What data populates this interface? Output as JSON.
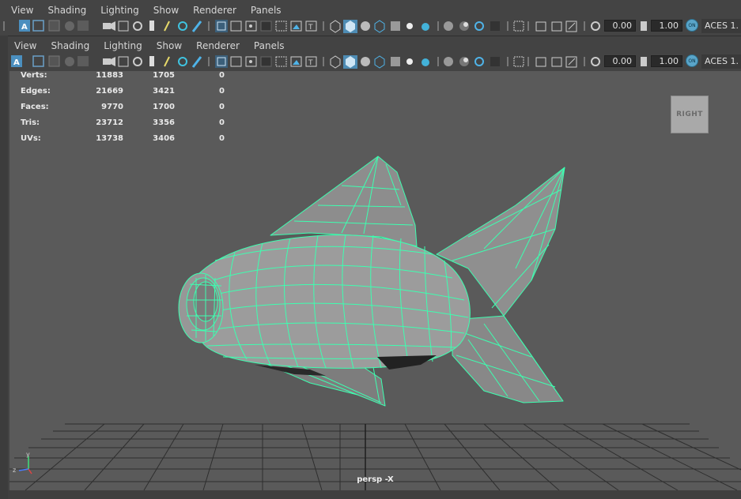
{
  "menus": {
    "outer": [
      "View",
      "Shading",
      "Lighting",
      "Show",
      "Renderer",
      "Panels"
    ],
    "inner": [
      "View",
      "Shading",
      "Lighting",
      "Show",
      "Renderer",
      "Panels"
    ]
  },
  "toolbar": {
    "exposure_value": "0.00",
    "gamma_value": "1.00",
    "color_space_label": "ACES 1.",
    "on_badge": "ON"
  },
  "hud": {
    "rows": [
      {
        "label": "Verts:",
        "total": "11883",
        "selected": "1705",
        "other": "0"
      },
      {
        "label": "Edges:",
        "total": "21669",
        "selected": "3421",
        "other": "0"
      },
      {
        "label": "Faces:",
        "total": "9770",
        "selected": "1700",
        "other": "0"
      },
      {
        "label": "Tris:",
        "total": "23712",
        "selected": "3356",
        "other": "0"
      },
      {
        "label": "UVs:",
        "total": "13738",
        "selected": "3406",
        "other": "0"
      }
    ]
  },
  "viewcube_label": "RIGHT",
  "camera_label": "persp -X",
  "axis": {
    "y": "y",
    "z": "z"
  },
  "colors": {
    "wireframe": "#3dffb0",
    "viewport_bg": "#5a5a5a",
    "highlight": "#5aa5c9"
  }
}
